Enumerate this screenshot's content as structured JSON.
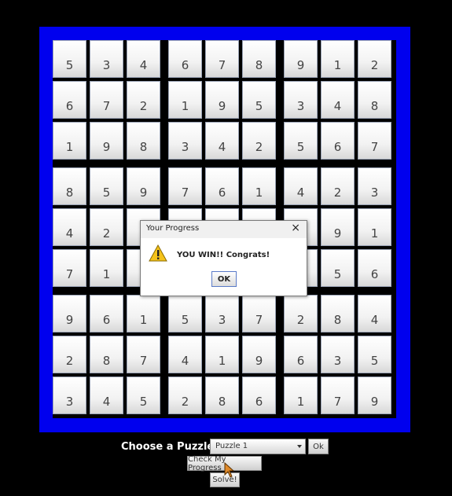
{
  "board": {
    "rows": [
      [
        "5",
        "3",
        "4",
        "6",
        "7",
        "8",
        "9",
        "1",
        "2"
      ],
      [
        "6",
        "7",
        "2",
        "1",
        "9",
        "5",
        "3",
        "4",
        "8"
      ],
      [
        "1",
        "9",
        "8",
        "3",
        "4",
        "2",
        "5",
        "6",
        "7"
      ],
      [
        "8",
        "5",
        "9",
        "7",
        "6",
        "1",
        "4",
        "2",
        "3"
      ],
      [
        "4",
        "2",
        "",
        "",
        "",
        "",
        "",
        "9",
        "1"
      ],
      [
        "7",
        "1",
        "",
        "",
        "",
        "",
        "",
        "5",
        "6"
      ],
      [
        "9",
        "6",
        "1",
        "5",
        "3",
        "7",
        "2",
        "8",
        "4"
      ],
      [
        "2",
        "8",
        "7",
        "4",
        "1",
        "9",
        "6",
        "3",
        "5"
      ],
      [
        "3",
        "4",
        "5",
        "2",
        "8",
        "6",
        "1",
        "7",
        "9"
      ]
    ],
    "frame_color": "#0000ee"
  },
  "controls": {
    "choose_label": "Choose a Puzzle:",
    "puzzle_select": "Puzzle 1",
    "ok_label": "Ok",
    "check_label": "Check My Progress",
    "solve_label": "Solve!"
  },
  "dialog": {
    "title": "Your Progress",
    "close_glyph": "×",
    "icon": "warning-icon",
    "message": "YOU WIN!! Congrats!",
    "ok_label": "OK"
  }
}
